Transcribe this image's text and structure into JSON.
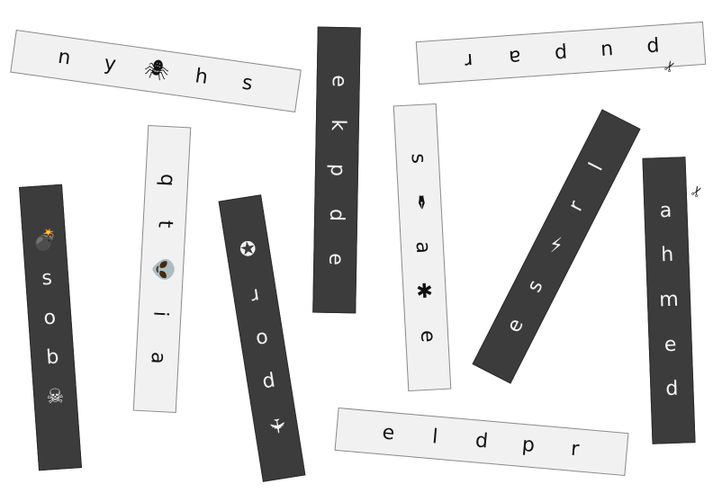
{
  "strips": [
    {
      "id": "s1",
      "tokens": [
        "n",
        "y",
        "🕷",
        "h",
        "s"
      ]
    },
    {
      "id": "s2",
      "tokens": [
        "e",
        "k",
        "p",
        "d",
        "e"
      ]
    },
    {
      "id": "s3",
      "tokens": [
        "p",
        "u",
        "p",
        "a",
        "r"
      ]
    },
    {
      "id": "s4",
      "tokens": [
        "💣",
        "s",
        "o",
        "b",
        "☠"
      ]
    },
    {
      "id": "s5",
      "tokens": [
        "q",
        "t",
        "👽",
        "i",
        "a"
      ]
    },
    {
      "id": "s6",
      "tokens": [
        "✪",
        "r",
        "o",
        "p",
        "✈"
      ]
    },
    {
      "id": "s7",
      "tokens": [
        "s",
        "✒",
        "a",
        "✱",
        "e"
      ]
    },
    {
      "id": "s8",
      "tokens": [
        "l",
        "r",
        "⚡",
        "s",
        "e"
      ]
    },
    {
      "id": "s9",
      "tokens": [
        "a",
        "h",
        "m",
        "e",
        "d"
      ]
    },
    {
      "id": "s10",
      "tokens": [
        "e",
        "l",
        "d",
        "p",
        "r"
      ]
    }
  ],
  "icons": {
    "scissors": "✂"
  }
}
